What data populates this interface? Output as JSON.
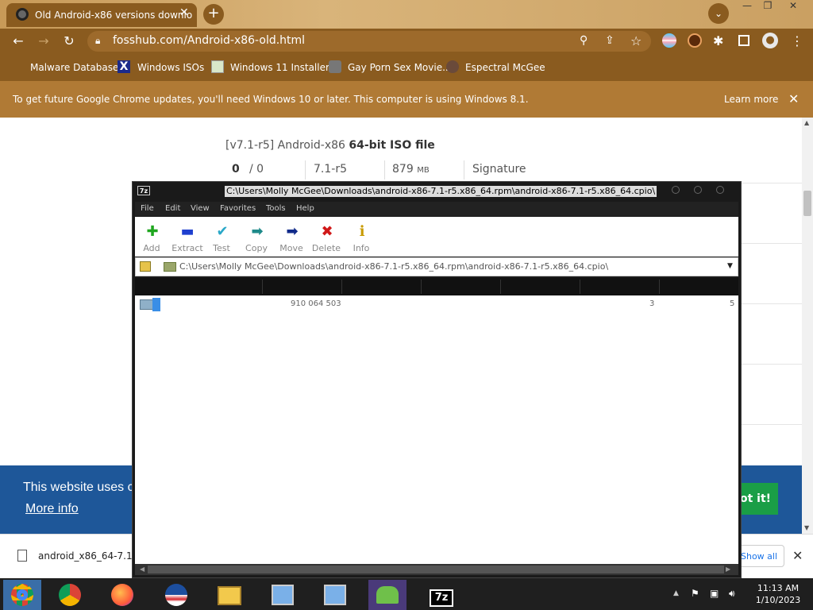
{
  "browser": {
    "tab_title": "Old Android-x86 versions downlo",
    "new_tab": "+",
    "tab_search": "⌄",
    "url": "fosshub.com/Android-x86-old.html",
    "bookmarks": [
      "Malware Database",
      "Windows ISOs",
      "Windows 11 Installer",
      "Gay Porn Sex Movie...",
      "Espectral McGee"
    ],
    "infobar_text": "To get future Google Chrome updates, you'll need Windows 10 or later. This computer is using Windows 8.1.",
    "learn_more": "Learn more"
  },
  "page": {
    "file_heading_prefix": "[v7.1-r5] Android-x86 ",
    "file_heading_bold": "64-bit ISO file",
    "votes_up": "0",
    "votes_sep": "/ 0",
    "version": "7.1-r5",
    "size_num": "879",
    "size_unit": "MB",
    "signature": "Signature",
    "cookie_text": "This website uses c",
    "more_info": "More info",
    "got_it": "ot it!",
    "download_file": "android_x86_64-7.1...",
    "show_all": "Show all"
  },
  "zip": {
    "title": "C:\\Users\\Molly McGee\\Downloads\\android-x86-7.1-r5.x86_64.rpm\\android-x86-7.1-r5.x86_64.cpio\\",
    "menu": [
      "File",
      "Edit",
      "View",
      "Favorites",
      "Tools",
      "Help"
    ],
    "tools": [
      {
        "label": "Add",
        "icon": "✚",
        "color": "#1fa61f"
      },
      {
        "label": "Extract",
        "icon": "▬",
        "color": "#1e3fcf"
      },
      {
        "label": "Test",
        "icon": "✔",
        "color": "#2aa8c8"
      },
      {
        "label": "Copy",
        "icon": "➡",
        "color": "#1f8a8a"
      },
      {
        "label": "Move",
        "icon": "➡",
        "color": "#102a8a"
      },
      {
        "label": "Delete",
        "icon": "✖",
        "color": "#d01818"
      },
      {
        "label": "Info",
        "icon": "ℹ",
        "color": "#c89a00"
      }
    ],
    "path": "C:\\Users\\Molly McGee\\Downloads\\android-x86-7.1-r5.x86_64.rpm\\android-x86-7.1-r5.x86_64.cpio\\",
    "row_size": "910 064 503",
    "row_col3": "3",
    "row_col4": "5"
  },
  "taskbar": {
    "icons": [
      "chrome-icon",
      "chrome-icon",
      "firefox-icon",
      "obama-icon",
      "file-explorer-icon",
      "installer-icon",
      "installer-icon",
      "users-icon",
      "7zip-icon"
    ],
    "time": "11:13 AM",
    "date": "1/10/2023",
    "sevenzip_label": "7z"
  }
}
